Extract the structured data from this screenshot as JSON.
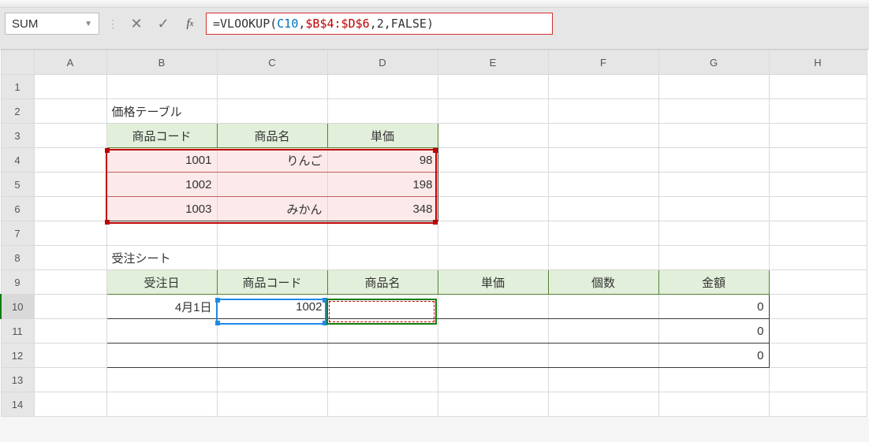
{
  "nameBox": "SUM",
  "formula": {
    "prefix": "=VLOOKUP",
    "paren1": "(",
    "arg1": "C10",
    "comma1": ",",
    "arg2": "$B$4:$D$6",
    "comma2": ",",
    "arg3": "2",
    "comma3": ",",
    "arg4": "FALSE",
    "paren2": ")"
  },
  "cols": [
    "A",
    "B",
    "C",
    "D",
    "E",
    "F",
    "G",
    "H"
  ],
  "rows": [
    "1",
    "2",
    "3",
    "4",
    "5",
    "6",
    "7",
    "8",
    "9",
    "10",
    "11",
    "12",
    "13",
    "14"
  ],
  "labels": {
    "priceTable": "価格テーブル",
    "orderSheet": "受注シート",
    "code": "商品コード",
    "name": "商品名",
    "unitPrice": "単価",
    "orderDate": "受注日",
    "qty": "個数",
    "amount": "金額"
  },
  "price": [
    {
      "code": "1001",
      "name": "りんご",
      "unit": "98"
    },
    {
      "code": "1002",
      "name": "",
      "unit": "198"
    },
    {
      "code": "1003",
      "name": "みかん",
      "unit": "348"
    }
  ],
  "orders": [
    {
      "date": "4月1日",
      "code": "1002",
      "name": "",
      "unit": "",
      "qty": "",
      "amount": "0"
    },
    {
      "date": "",
      "code": "",
      "name": "",
      "unit": "",
      "qty": "",
      "amount": "0"
    },
    {
      "date": "",
      "code": "",
      "name": "",
      "unit": "",
      "qty": "",
      "amount": "0"
    }
  ]
}
